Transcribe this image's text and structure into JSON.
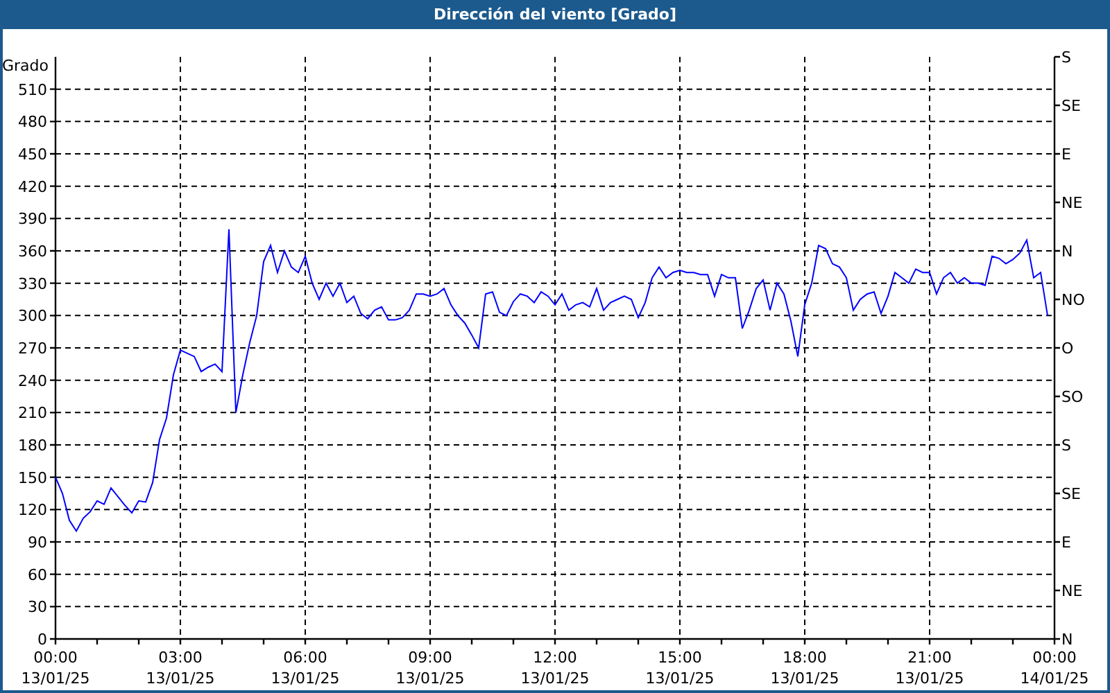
{
  "window": {
    "title": "Dirección del viento [Grado]"
  },
  "chart": {
    "right_axis_labels": [
      "S",
      "SE",
      "E",
      "NE",
      "N",
      "NO",
      "O",
      "SO",
      "S",
      "SE",
      "E",
      "NE",
      "N"
    ],
    "chart_data": {
      "type": "line",
      "grid": true,
      "ylabel": "Grado",
      "ylim": [
        0,
        540
      ],
      "categories": [
        "00:00 13/01/25",
        null,
        null,
        null,
        null,
        null,
        null,
        null,
        null,
        null,
        null,
        null,
        null,
        null,
        null,
        null,
        null,
        null,
        "03:00 13/01/25",
        null,
        null,
        null,
        null,
        null,
        null,
        null,
        null,
        null,
        null,
        null,
        null,
        null,
        null,
        null,
        null,
        null,
        "06:00 13/01/25",
        null,
        null,
        null,
        null,
        null,
        null,
        null,
        null,
        null,
        null,
        null,
        null,
        null,
        null,
        null,
        null,
        null,
        "09:00 13/01/25",
        null,
        null,
        null,
        null,
        null,
        null,
        null,
        null,
        null,
        null,
        null,
        null,
        null,
        null,
        null,
        null,
        null,
        "12:00 13/01/25",
        null,
        null,
        null,
        null,
        null,
        null,
        null,
        null,
        null,
        null,
        null,
        null,
        null,
        null,
        null,
        null,
        null,
        "15:00 13/01/25",
        null,
        null,
        null,
        null,
        null,
        null,
        null,
        null,
        null,
        null,
        null,
        null,
        null,
        null,
        null,
        null,
        null,
        "18:00 13/01/25",
        null,
        null,
        null,
        null,
        null,
        null,
        null,
        null,
        null,
        null,
        null,
        null,
        null,
        null,
        null,
        null,
        null,
        "21:00 13/01/25",
        null,
        null,
        null,
        null,
        null,
        null,
        null,
        null,
        null,
        null,
        null,
        null,
        null,
        null,
        null,
        null,
        null,
        "00:00 14/01/25"
      ],
      "series": [
        {
          "color": "#0000ff",
          "values": [
            150,
            135,
            110,
            100,
            112,
            118,
            128,
            125,
            140,
            132,
            124,
            117,
            128,
            127,
            145,
            185,
            205,
            245,
            268,
            265,
            262,
            248,
            252,
            255,
            248,
            380,
            210,
            245,
            275,
            300,
            350,
            365,
            340,
            360,
            345,
            340,
            355,
            330,
            315,
            330,
            318,
            330,
            312,
            318,
            302,
            297,
            305,
            308,
            296,
            296,
            298,
            305,
            320,
            320,
            318,
            320,
            325,
            310,
            300,
            293,
            282,
            270,
            320,
            322,
            303,
            300,
            313,
            320,
            318,
            312,
            322,
            318,
            310,
            320,
            305,
            310,
            312,
            308,
            325,
            305,
            312,
            315,
            318,
            315,
            298,
            312,
            335,
            345,
            335,
            340,
            342,
            340,
            340,
            338,
            338,
            318,
            338,
            335,
            335,
            288,
            305,
            325,
            333,
            305,
            330,
            320,
            295,
            262,
            310,
            330,
            365,
            362,
            348,
            345,
            335,
            305,
            315,
            320,
            322,
            302,
            318,
            340,
            335,
            330,
            343,
            340,
            340,
            320,
            335,
            340,
            330,
            335,
            330,
            330,
            328,
            355,
            353,
            348,
            352,
            358,
            370,
            335,
            340,
            300,
            null
          ]
        }
      ],
      "yticks": [
        0,
        30,
        60,
        90,
        120,
        150,
        180,
        210,
        240,
        270,
        300,
        330,
        360,
        390,
        420,
        450,
        480,
        510
      ]
    }
  }
}
